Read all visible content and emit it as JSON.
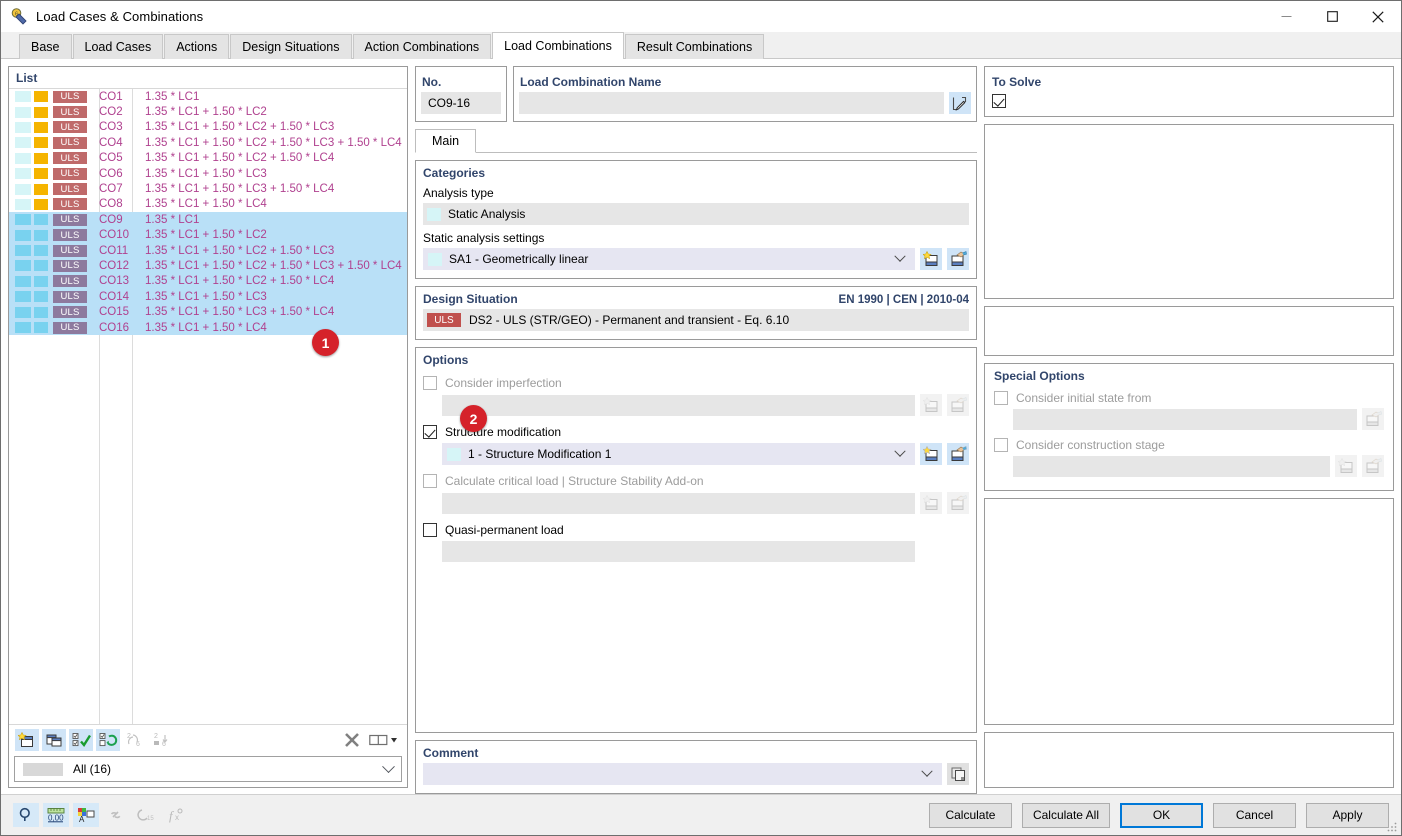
{
  "window": {
    "title": "Load Cases & Combinations",
    "minimize": "—",
    "maximize": "☐",
    "close": "✕"
  },
  "tabs": [
    {
      "label": "Base",
      "active": false
    },
    {
      "label": "Load Cases",
      "active": false
    },
    {
      "label": "Actions",
      "active": false
    },
    {
      "label": "Design Situations",
      "active": false
    },
    {
      "label": "Action Combinations",
      "active": false
    },
    {
      "label": "Load Combinations",
      "active": true
    },
    {
      "label": "Result Combinations",
      "active": false
    }
  ],
  "list": {
    "caption": "List",
    "rows": [
      {
        "no": "CO1",
        "tag": "ULS",
        "expr": "1.35 * LC1",
        "selected": false
      },
      {
        "no": "CO2",
        "tag": "ULS",
        "expr": "1.35 * LC1 + 1.50 * LC2",
        "selected": false
      },
      {
        "no": "CO3",
        "tag": "ULS",
        "expr": "1.35 * LC1 + 1.50 * LC2 + 1.50 * LC3",
        "selected": false
      },
      {
        "no": "CO4",
        "tag": "ULS",
        "expr": "1.35 * LC1 + 1.50 * LC2 + 1.50 * LC3 + 1.50 * LC4",
        "selected": false
      },
      {
        "no": "CO5",
        "tag": "ULS",
        "expr": "1.35 * LC1 + 1.50 * LC2 + 1.50 * LC4",
        "selected": false
      },
      {
        "no": "CO6",
        "tag": "ULS",
        "expr": "1.35 * LC1 + 1.50 * LC3",
        "selected": false
      },
      {
        "no": "CO7",
        "tag": "ULS",
        "expr": "1.35 * LC1 + 1.50 * LC3 + 1.50 * LC4",
        "selected": false
      },
      {
        "no": "CO8",
        "tag": "ULS",
        "expr": "1.35 * LC1 + 1.50 * LC4",
        "selected": false
      },
      {
        "no": "CO9",
        "tag": "ULS",
        "expr": "1.35 * LC1",
        "selected": true
      },
      {
        "no": "CO10",
        "tag": "ULS",
        "expr": "1.35 * LC1 + 1.50 * LC2",
        "selected": true
      },
      {
        "no": "CO11",
        "tag": "ULS",
        "expr": "1.35 * LC1 + 1.50 * LC2 + 1.50 * LC3",
        "selected": true
      },
      {
        "no": "CO12",
        "tag": "ULS",
        "expr": "1.35 * LC1 + 1.50 * LC2 + 1.50 * LC3 + 1.50 * LC4",
        "selected": true
      },
      {
        "no": "CO13",
        "tag": "ULS",
        "expr": "1.35 * LC1 + 1.50 * LC2 + 1.50 * LC4",
        "selected": true
      },
      {
        "no": "CO14",
        "tag": "ULS",
        "expr": "1.35 * LC1 + 1.50 * LC3",
        "selected": true
      },
      {
        "no": "CO15",
        "tag": "ULS",
        "expr": "1.35 * LC1 + 1.50 * LC3 + 1.50 * LC4",
        "selected": true
      },
      {
        "no": "CO16",
        "tag": "ULS",
        "expr": "1.35 * LC1 + 1.50 * LC4",
        "selected": true
      }
    ],
    "toolbar": [
      {
        "name": "new-combination-icon",
        "enabled": true
      },
      {
        "name": "copy-combination-icon",
        "enabled": true
      },
      {
        "name": "select-all-icon",
        "enabled": true
      },
      {
        "name": "invert-selection-icon",
        "enabled": true
      },
      {
        "name": "renumber-icon",
        "enabled": false
      },
      {
        "name": "sort-icon",
        "enabled": false
      },
      {
        "name": "delete-icon",
        "enabled": true
      },
      {
        "name": "view-mode-icon",
        "enabled": true
      }
    ],
    "filter": "All (16)"
  },
  "callouts": [
    {
      "label": "1"
    },
    {
      "label": "2"
    }
  ],
  "header": {
    "no_label": "No.",
    "no_value": "CO9-16",
    "name_label": "Load Combination Name",
    "name_value": "",
    "name_edit_icon": "edit-icon",
    "to_solve_label": "To Solve",
    "to_solve_checked": true
  },
  "inner_tabs": [
    {
      "label": "Main",
      "active": true
    }
  ],
  "categories": {
    "title": "Categories",
    "analysis_type_label": "Analysis type",
    "analysis_type_value": "Static Analysis",
    "static_settings_label": "Static analysis settings",
    "static_settings_value": "SA1 - Geometrically linear",
    "new_icon": "new-item-icon",
    "edit_icon": "edit-item-icon"
  },
  "design_situation": {
    "title": "Design Situation",
    "standard": "EN 1990 | CEN | 2010-04",
    "tag": "ULS",
    "value": "DS2 - ULS (STR/GEO) - Permanent and transient - Eq. 6.10"
  },
  "options": {
    "title": "Options",
    "items": [
      {
        "label": "Consider imperfection",
        "checked": false,
        "enabled": false,
        "field_value": "",
        "field_style": "grey",
        "buttons": [
          "new-item-icon",
          "edit-item-icon"
        ],
        "buttons_enabled": false
      },
      {
        "label": "Structure modification",
        "checked": true,
        "enabled": true,
        "field_value": "1 - Structure Modification 1",
        "field_style": "select",
        "buttons": [
          "new-item-icon",
          "edit-item-icon"
        ],
        "buttons_enabled": true
      },
      {
        "label": "Calculate critical load | Structure Stability Add-on",
        "checked": false,
        "enabled": false,
        "field_value": "",
        "field_style": "grey",
        "buttons": [
          "new-item-icon",
          "edit-item-icon"
        ],
        "buttons_enabled": false
      },
      {
        "label": "Quasi-permanent load",
        "checked": false,
        "enabled": true,
        "field_value": "",
        "field_style": "grey",
        "buttons": [],
        "buttons_enabled": false
      }
    ]
  },
  "comment": {
    "title": "Comment",
    "value": "",
    "copy_icon": "copy-icon"
  },
  "special_options": {
    "title": "Special Options",
    "items": [
      {
        "label": "Consider initial state from",
        "checked": false,
        "enabled": false,
        "field_value": "",
        "buttons": [
          "edit-item-icon"
        ]
      },
      {
        "label": "Consider construction stage",
        "checked": false,
        "enabled": false,
        "field_value": "",
        "buttons": [
          "new-item-icon",
          "edit-item-icon"
        ]
      }
    ]
  },
  "footer": {
    "icons": [
      {
        "name": "search-icon",
        "enabled": true
      },
      {
        "name": "units-icon",
        "enabled": true
      },
      {
        "name": "colors-icon",
        "enabled": true
      },
      {
        "name": "link-icon",
        "enabled": false
      },
      {
        "name": "snap-icon",
        "enabled": false
      },
      {
        "name": "formula-icon",
        "enabled": false
      }
    ],
    "buttons": [
      {
        "label": "Calculate",
        "default": false
      },
      {
        "label": "Calculate All",
        "default": false
      },
      {
        "label": "OK",
        "default": true
      },
      {
        "label": "Cancel",
        "default": false
      },
      {
        "label": "Apply",
        "default": false
      }
    ]
  },
  "colors": {
    "accent_pink": "#b0418f",
    "uls_badge": "#bf6a6a",
    "uls_badge_selected": "#8d7a9e",
    "uls_tag_design": "#c0504d",
    "selection": "#b9e0f7",
    "swatch_cyan": "#d6f5f7",
    "swatch_orange": "#f5b400",
    "swatch_selected": "#79d2ef",
    "group_title": "#31456b",
    "callout_red": "#d5222a",
    "default_button_border": "#0078d7"
  }
}
